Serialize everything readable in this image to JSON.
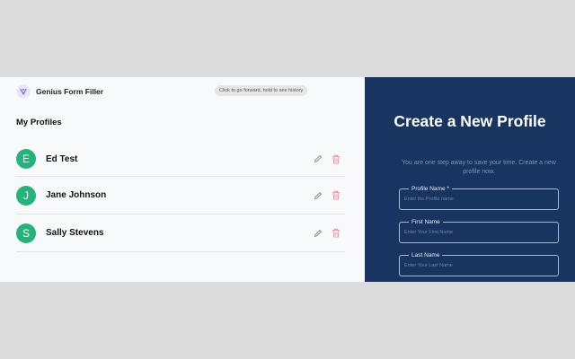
{
  "app": {
    "name": "Genius Form Filler",
    "tooltip": "Click to go forward, hold to see history"
  },
  "profiles": {
    "title": "My Profiles",
    "items": [
      {
        "initial": "E",
        "name": "Ed Test"
      },
      {
        "initial": "J",
        "name": "Jane Johnson"
      },
      {
        "initial": "S",
        "name": "Sally Stevens"
      }
    ],
    "icons": {
      "edit": "pencil-icon",
      "delete": "trash-icon"
    }
  },
  "create": {
    "heading": "Create a New Profile",
    "subtitle": "You are one step away to save your time. Create a new profile now.",
    "fields": [
      {
        "label": "Profile Name *",
        "placeholder": "Enter the Profile name"
      },
      {
        "label": "First Name",
        "placeholder": "Enter Your First Name"
      },
      {
        "label": "Last Name",
        "placeholder": "Enter Your Last Name"
      }
    ]
  },
  "colors": {
    "accent": "#25b27b",
    "panel": "#173560",
    "delete": "#e8828a"
  }
}
